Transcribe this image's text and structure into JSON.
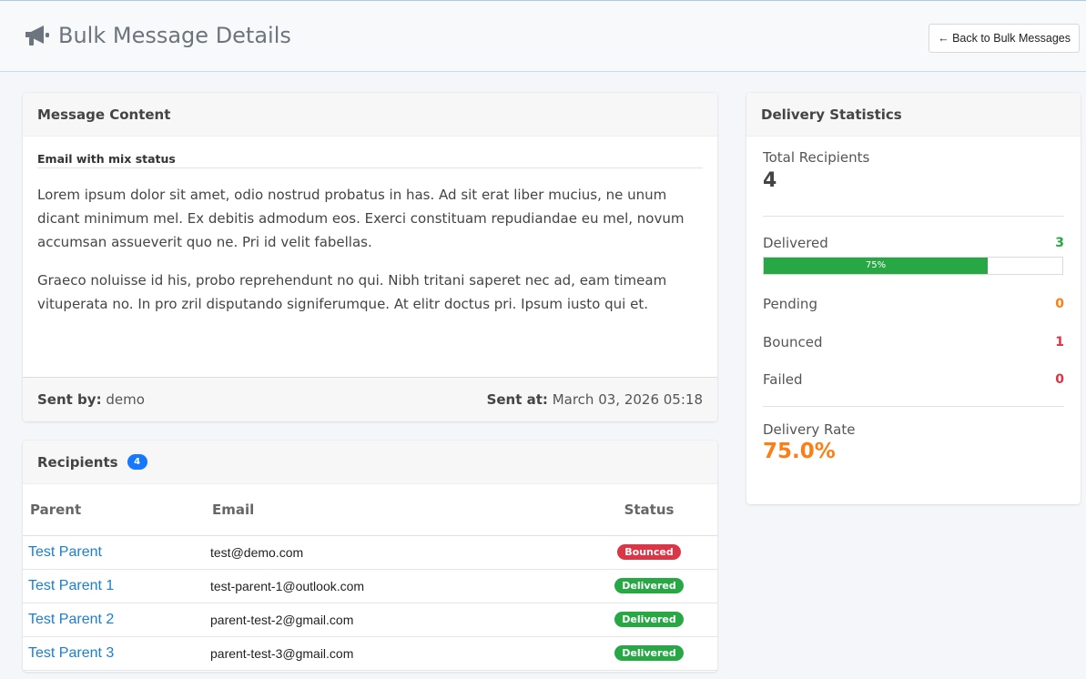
{
  "header": {
    "title": "Bulk Message Details",
    "back_label": "← Back to Bulk Messages",
    "icon": "megaphone-icon"
  },
  "message": {
    "header": "Message Content",
    "subject": "Email with mix status",
    "paragraphs": [
      "Lorem ipsum dolor sit amet, odio nostrud probatus in has. Ad sit erat liber mucius, ne unum dicant minimum mel. Ex debitis admodum eos. Exerci constituam repudiandae eu mel, novum accumsan assueverit quo ne. Pri id velit fabellas.",
      "Graeco noluisse id his, probo reprehendunt no qui. Nibh tritani saperet nec ad, eam timeam vituperata no. In pro zril disputando signiferumque. At elitr doctus pri. Ipsum iusto qui et."
    ],
    "sent_by_label": "Sent by:",
    "sent_by": "demo",
    "sent_at_label": "Sent at:",
    "sent_at": "March 03, 2026 05:18"
  },
  "recipients": {
    "header": "Recipients",
    "count": "4",
    "columns": [
      "Parent",
      "Email",
      "Status"
    ],
    "rows": [
      {
        "parent": "Test Parent",
        "email": "test@demo.com",
        "status": "Bounced"
      },
      {
        "parent": "Test Parent 1",
        "email": "test-parent-1@outlook.com",
        "status": "Delivered"
      },
      {
        "parent": "Test Parent 2",
        "email": "parent-test-2@gmail.com",
        "status": "Delivered"
      },
      {
        "parent": "Test Parent 3",
        "email": "parent-test-3@gmail.com",
        "status": "Delivered"
      }
    ]
  },
  "stats": {
    "header": "Delivery Statistics",
    "total_label": "Total Recipients",
    "total": "4",
    "delivered_label": "Delivered",
    "delivered": "3",
    "delivered_pct": "75%",
    "delivered_fraction": 0.75,
    "pending_label": "Pending",
    "pending": "0",
    "bounced_label": "Bounced",
    "bounced": "1",
    "failed_label": "Failed",
    "failed": "0",
    "rate_label": "Delivery Rate",
    "rate": "75.0%"
  },
  "colors": {
    "success": "#28a745",
    "danger": "#dc3545",
    "warning": "#fd7e14",
    "primary": "#1677ff",
    "link": "#1a7fd0"
  }
}
